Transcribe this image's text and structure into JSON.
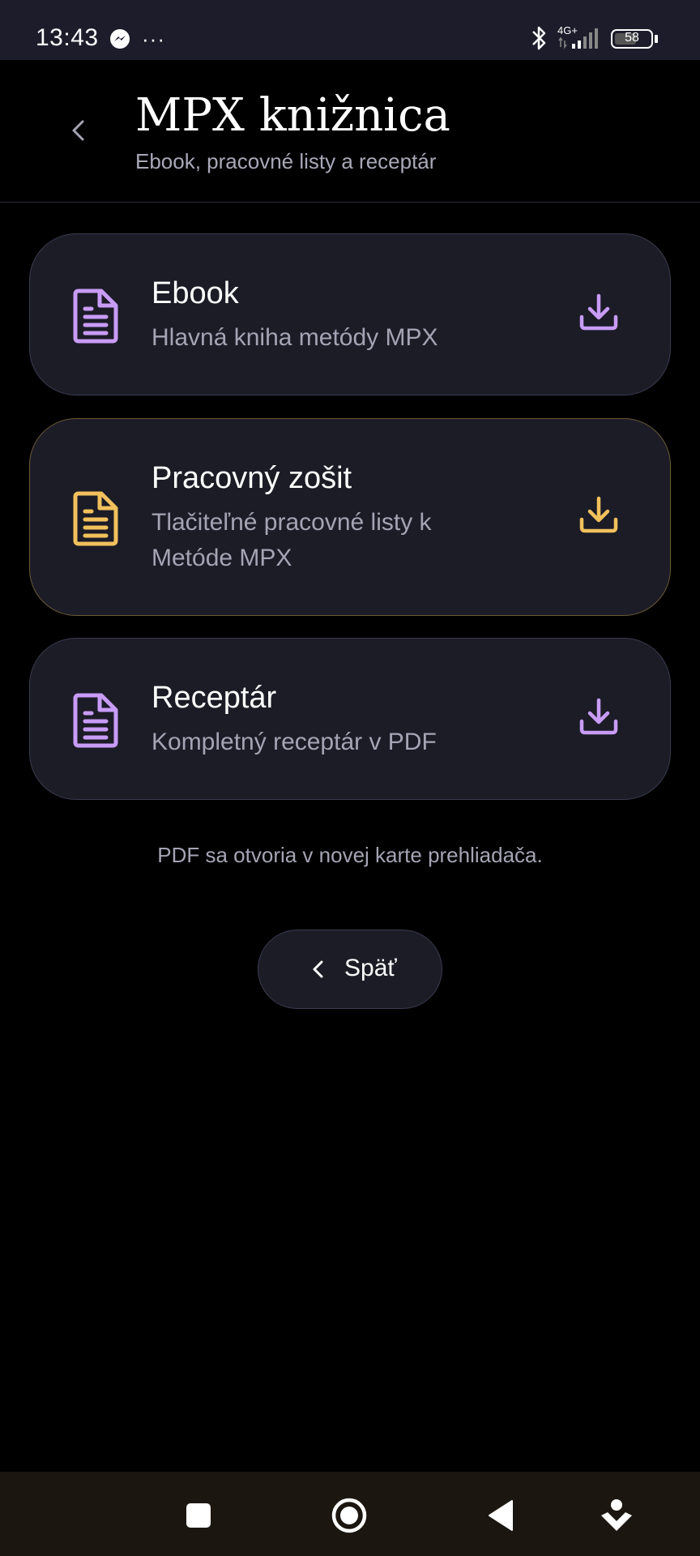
{
  "status_bar": {
    "time": "13:43",
    "network": "4G+",
    "battery": "58",
    "battery_level": 0.58,
    "icons": [
      "messenger-icon",
      "more-dots-icon",
      "bluetooth-icon",
      "signal-icon",
      "battery-icon"
    ],
    "more": "···"
  },
  "header": {
    "title": "MPX knižnica",
    "subtitle": "Ebook, pracovné listy a receptár"
  },
  "colors": {
    "background": "#000000",
    "card_bg": "#1c1c27",
    "purple_accent": "#c89cf7",
    "gold_accent": "#f2c15c",
    "muted_text": "#a4a4b4"
  },
  "cards": [
    {
      "title": "Ebook",
      "description": "Hlavná kniha metódy MPX",
      "accent": "purple",
      "icon": "document-icon",
      "action_icon": "download-icon"
    },
    {
      "title": "Pracovný zošit",
      "description": "Tlačiteľné pracovné listy k Metóde MPX",
      "accent": "gold",
      "icon": "document-icon",
      "action_icon": "download-icon"
    },
    {
      "title": "Receptár",
      "description": "Kompletný receptár v PDF",
      "accent": "purple",
      "icon": "document-icon",
      "action_icon": "download-icon"
    }
  ],
  "note": "PDF sa otvoria v novej karte prehliadača.",
  "back_button": {
    "label": "Späť"
  },
  "nav_bar": {
    "buttons": [
      "recents-square-icon",
      "home-circle-icon",
      "back-triangle-icon",
      "assistant-icon"
    ]
  }
}
